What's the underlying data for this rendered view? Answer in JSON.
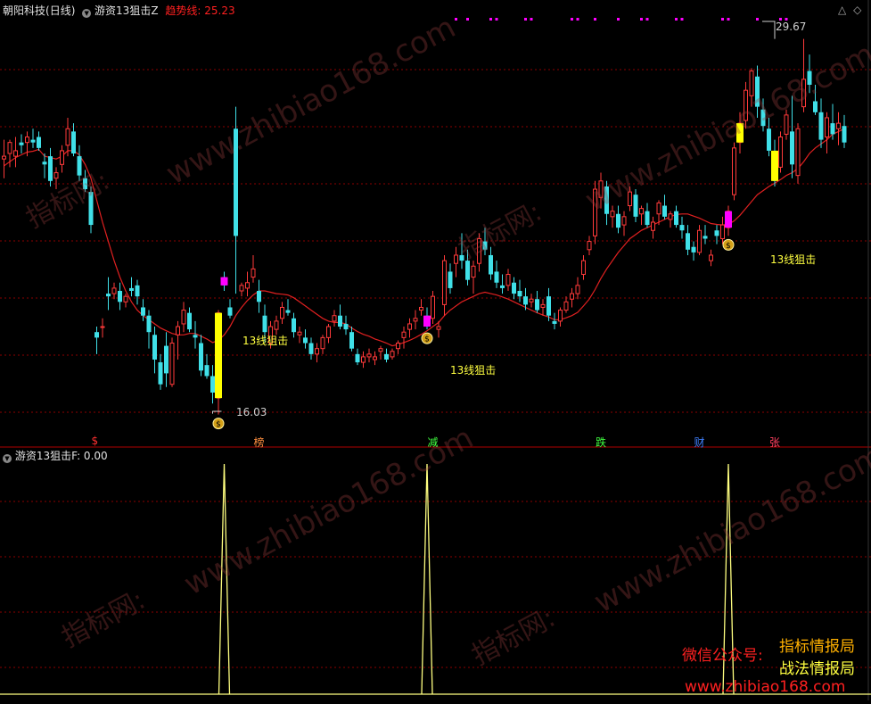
{
  "header": {
    "stock_name": "朝阳科技",
    "period": "(日线)",
    "indicator_name": "游资13狙击Z",
    "trend_label": "趋势线:",
    "trend_value": "25.23"
  },
  "sub_header": {
    "indicator_name": "游资13狙击F",
    "value_text": ": 0.00"
  },
  "annotations": {
    "high_label": "29.67",
    "low_label": "16.03",
    "signal_label": "13线狙击"
  },
  "event_marks": [
    {
      "text": "$",
      "color": "#ff3030"
    },
    {
      "text": "榜",
      "color": "#ff9040"
    },
    {
      "text": "减",
      "color": "#40ff40"
    },
    {
      "text": "跌",
      "color": "#40ff40"
    },
    {
      "text": "财",
      "color": "#4080ff"
    },
    {
      "text": "张",
      "color": "#ff4060"
    }
  ],
  "promo": {
    "wechat": "微信公众号:",
    "line1": "指标情报局",
    "line2": "战法情报局",
    "site": "www.zhibiao168.com"
  },
  "watermark": {
    "site": "www.zhibiao168.com",
    "cn": "指标网:"
  },
  "colors": {
    "up": "#ff3a3a",
    "down": "#40e0e8",
    "trend_line": "#e02020",
    "signal_bar": "#ffff00",
    "magenta_bar": "#ff00ff",
    "grid": "#8b0000",
    "spike": "#ffff80",
    "border": "#b00000"
  },
  "icons": [
    "money-bag-icon",
    "collapse-triangle-icon",
    "diamond-icon"
  ],
  "chart_data": {
    "type": "candlestick",
    "title": "朝阳科技 (日线)",
    "ylim": [
      15.5,
      30.5
    ],
    "labeled_high": 29.67,
    "labeled_low": 16.03,
    "trend_line_last": 25.23,
    "candles": [
      [
        25.3,
        26.0,
        24.6,
        25.4
      ],
      [
        25.5,
        26.0,
        25.0,
        25.9
      ],
      [
        25.4,
        26.1,
        25.0,
        25.6
      ],
      [
        25.9,
        26.2,
        25.5,
        25.8
      ],
      [
        25.9,
        26.3,
        25.4,
        26.1
      ],
      [
        26.0,
        26.4,
        25.7,
        25.9
      ],
      [
        26.1,
        26.3,
        25.6,
        25.7
      ],
      [
        25.2,
        25.5,
        24.6,
        25.1
      ],
      [
        25.4,
        25.7,
        24.3,
        24.5
      ],
      [
        24.6,
        25.0,
        24.2,
        24.8
      ],
      [
        25.1,
        25.8,
        24.8,
        25.6
      ],
      [
        25.8,
        26.8,
        25.4,
        26.4
      ],
      [
        26.3,
        26.6,
        25.4,
        25.5
      ],
      [
        25.4,
        25.8,
        24.5,
        24.7
      ],
      [
        24.6,
        24.9,
        24.1,
        24.2
      ],
      [
        24.1,
        24.3,
        22.6,
        22.9
      ],
      [
        19.0,
        19.2,
        18.2,
        18.8
      ],
      [
        19.2,
        19.5,
        18.8,
        19.2
      ],
      [
        20.4,
        21.0,
        19.8,
        20.3
      ],
      [
        20.4,
        20.8,
        20.2,
        20.6
      ],
      [
        20.5,
        20.8,
        19.8,
        20.1
      ],
      [
        20.1,
        20.4,
        19.9,
        20.3
      ],
      [
        20.6,
        21.0,
        20.3,
        20.5
      ],
      [
        20.7,
        20.9,
        20.0,
        20.3
      ],
      [
        19.9,
        20.2,
        19.4,
        19.6
      ],
      [
        19.6,
        19.8,
        18.4,
        19.0
      ],
      [
        18.9,
        19.2,
        17.5,
        18.0
      ],
      [
        17.9,
        18.2,
        16.9,
        17.1
      ],
      [
        18.5,
        19.0,
        17.0,
        17.5
      ],
      [
        17.1,
        18.8,
        17.0,
        18.6
      ],
      [
        18.9,
        19.4,
        18.0,
        19.2
      ],
      [
        19.3,
        20.1,
        19.0,
        19.8
      ],
      [
        19.7,
        19.9,
        19.0,
        19.1
      ],
      [
        18.9,
        19.4,
        18.4,
        18.8
      ],
      [
        18.6,
        18.9,
        17.4,
        17.6
      ],
      [
        17.8,
        18.2,
        17.3,
        17.4
      ],
      [
        17.4,
        17.8,
        16.4,
        16.8
      ],
      [
        16.6,
        19.8,
        16.0,
        19.7
      ],
      [
        21.0,
        21.2,
        20.5,
        20.7
      ],
      [
        19.9,
        20.2,
        19.5,
        19.6
      ],
      [
        26.4,
        27.2,
        20.4,
        22.5
      ],
      [
        20.5,
        20.8,
        20.3,
        20.7
      ],
      [
        20.6,
        21.2,
        20.3,
        20.8
      ],
      [
        21.0,
        21.8,
        20.8,
        21.3
      ],
      [
        20.5,
        20.9,
        19.7,
        20.1
      ],
      [
        19.6,
        20.0,
        18.6,
        19.0
      ],
      [
        18.6,
        19.4,
        18.4,
        19.2
      ],
      [
        19.1,
        19.6,
        18.9,
        19.4
      ],
      [
        19.5,
        20.1,
        19.3,
        19.9
      ],
      [
        19.8,
        20.2,
        19.6,
        19.7
      ],
      [
        19.5,
        19.7,
        18.8,
        19.0
      ],
      [
        18.9,
        19.2,
        18.6,
        19.0
      ],
      [
        18.8,
        19.1,
        18.4,
        18.6
      ],
      [
        18.6,
        18.8,
        18.0,
        18.2
      ],
      [
        18.2,
        18.6,
        17.9,
        18.4
      ],
      [
        18.4,
        18.9,
        18.2,
        18.8
      ],
      [
        18.8,
        19.3,
        18.6,
        19.2
      ],
      [
        19.4,
        19.8,
        19.2,
        19.6
      ],
      [
        19.6,
        20.0,
        19.1,
        19.2
      ],
      [
        19.3,
        19.6,
        18.9,
        19.1
      ],
      [
        19.0,
        19.2,
        18.3,
        18.4
      ],
      [
        18.2,
        18.4,
        17.8,
        17.9
      ],
      [
        17.9,
        18.3,
        17.7,
        18.1
      ],
      [
        18.1,
        18.4,
        17.9,
        18.2
      ],
      [
        18.0,
        18.3,
        17.8,
        18.1
      ],
      [
        18.3,
        18.5,
        18.0,
        18.4
      ],
      [
        18.2,
        18.4,
        17.9,
        18.0
      ],
      [
        18.1,
        18.4,
        18.0,
        18.3
      ],
      [
        18.4,
        18.7,
        18.2,
        18.6
      ],
      [
        18.8,
        19.2,
        18.4,
        19.0
      ],
      [
        19.1,
        19.5,
        18.8,
        19.3
      ],
      [
        19.4,
        19.8,
        19.1,
        19.5
      ],
      [
        19.8,
        20.2,
        19.6,
        19.9
      ],
      [
        19.6,
        19.9,
        19.1,
        19.2
      ],
      [
        19.5,
        20.5,
        19.3,
        20.3
      ],
      [
        19.1,
        19.4,
        18.8,
        19.2
      ],
      [
        20.0,
        21.8,
        19.6,
        21.6
      ],
      [
        21.2,
        21.5,
        20.4,
        20.6
      ],
      [
        21.5,
        22.1,
        21.0,
        21.8
      ],
      [
        21.8,
        22.6,
        21.3,
        21.6
      ],
      [
        21.6,
        22.0,
        20.7,
        20.9
      ],
      [
        21.0,
        21.6,
        20.4,
        21.4
      ],
      [
        21.5,
        22.6,
        21.2,
        22.4
      ],
      [
        22.3,
        22.8,
        21.8,
        22.0
      ],
      [
        21.8,
        22.1,
        20.9,
        21.1
      ],
      [
        21.2,
        21.6,
        20.6,
        20.8
      ],
      [
        20.7,
        21.1,
        20.4,
        20.6
      ],
      [
        20.7,
        21.3,
        20.5,
        21.1
      ],
      [
        20.8,
        21.0,
        20.2,
        20.4
      ],
      [
        20.5,
        20.9,
        20.1,
        20.3
      ],
      [
        20.3,
        20.6,
        19.8,
        20.0
      ],
      [
        20.1,
        20.4,
        19.9,
        20.2
      ],
      [
        20.2,
        20.5,
        19.7,
        19.8
      ],
      [
        19.9,
        20.2,
        19.6,
        20.0
      ],
      [
        20.3,
        20.6,
        19.4,
        19.6
      ],
      [
        19.4,
        19.7,
        19.1,
        19.3
      ],
      [
        19.4,
        19.9,
        19.2,
        19.8
      ],
      [
        19.8,
        20.3,
        19.7,
        20.1
      ],
      [
        20.2,
        20.6,
        19.9,
        20.4
      ],
      [
        20.4,
        21.0,
        20.2,
        20.7
      ],
      [
        21.1,
        21.8,
        20.9,
        21.6
      ],
      [
        22.0,
        22.5,
        21.8,
        22.3
      ],
      [
        22.5,
        24.5,
        22.2,
        24.2
      ],
      [
        23.9,
        24.8,
        23.5,
        24.5
      ],
      [
        24.3,
        24.5,
        22.9,
        23.3
      ],
      [
        23.2,
        23.6,
        22.8,
        23.4
      ],
      [
        23.3,
        23.6,
        22.6,
        22.8
      ],
      [
        22.9,
        23.4,
        22.5,
        23.2
      ],
      [
        23.6,
        24.3,
        23.4,
        24.1
      ],
      [
        24.0,
        24.2,
        23.0,
        23.2
      ],
      [
        23.3,
        23.6,
        22.9,
        23.5
      ],
      [
        23.4,
        23.7,
        22.8,
        22.9
      ],
      [
        22.7,
        23.2,
        22.4,
        23.0
      ],
      [
        23.3,
        23.8,
        22.9,
        23.7
      ],
      [
        23.6,
        24.0,
        23.1,
        23.2
      ],
      [
        23.1,
        23.4,
        22.8,
        23.3
      ],
      [
        23.4,
        23.6,
        22.8,
        22.9
      ],
      [
        22.9,
        23.2,
        22.4,
        22.7
      ],
      [
        22.6,
        22.9,
        21.8,
        22.0
      ],
      [
        22.1,
        22.3,
        21.6,
        21.9
      ],
      [
        21.9,
        22.9,
        21.8,
        22.7
      ],
      [
        22.5,
        22.9,
        22.2,
        22.4
      ],
      [
        21.6,
        22.0,
        21.4,
        21.8
      ],
      [
        22.7,
        22.9,
        22.2,
        22.5
      ],
      [
        22.4,
        23.2,
        22.2,
        22.9
      ],
      [
        22.8,
        23.6,
        22.5,
        23.4
      ],
      [
        24.0,
        25.9,
        23.8,
        25.7
      ],
      [
        25.9,
        27.0,
        25.5,
        26.6
      ],
      [
        26.7,
        28.1,
        26.4,
        27.8
      ],
      [
        27.6,
        28.6,
        27.2,
        28.5
      ],
      [
        28.3,
        28.7,
        26.8,
        27.2
      ],
      [
        27.1,
        27.5,
        26.3,
        26.5
      ],
      [
        26.4,
        26.8,
        25.4,
        25.6
      ],
      [
        25.6,
        26.0,
        24.3,
        24.5
      ],
      [
        25.0,
        26.3,
        24.8,
        26.1
      ],
      [
        26.2,
        27.1,
        26.0,
        26.9
      ],
      [
        26.3,
        27.6,
        24.6,
        25.1
      ],
      [
        24.7,
        26.6,
        24.4,
        26.4
      ],
      [
        27.2,
        29.67,
        27.0,
        28.2
      ],
      [
        28.5,
        29.1,
        27.7,
        28.0
      ],
      [
        27.4,
        28.0,
        26.9,
        27.0
      ],
      [
        27.0,
        27.5,
        25.7,
        26.0
      ],
      [
        26.1,
        27.0,
        25.5,
        26.8
      ],
      [
        26.6,
        27.3,
        26.0,
        26.2
      ],
      [
        26.4,
        27.0,
        25.8,
        26.6
      ],
      [
        26.5,
        26.9,
        25.7,
        25.9
      ]
    ],
    "trend_line": [
      25.05,
      25.2,
      25.35,
      25.45,
      25.55,
      25.58,
      25.65,
      25.4,
      25.35,
      25.3,
      25.4,
      25.6,
      25.6,
      25.45,
      25.1,
      24.6,
      23.8,
      23.0,
      22.3,
      21.6,
      21.0,
      20.5,
      20.1,
      19.8,
      19.6,
      19.45,
      19.3,
      19.15,
      19.05,
      18.95,
      18.9,
      18.9,
      18.95,
      18.95,
      18.85,
      18.75,
      18.62,
      18.7,
      18.9,
      19.2,
      19.6,
      19.9,
      20.15,
      20.35,
      20.5,
      20.5,
      20.45,
      20.4,
      20.38,
      20.35,
      20.25,
      20.1,
      19.95,
      19.8,
      19.65,
      19.5,
      19.4,
      19.35,
      19.35,
      19.3,
      19.15,
      19.02,
      18.92,
      18.85,
      18.75,
      18.68,
      18.6,
      18.5,
      18.55,
      18.62,
      18.7,
      18.8,
      18.92,
      19.05,
      19.2,
      19.35,
      19.6,
      19.8,
      19.95,
      20.1,
      20.2,
      20.3,
      20.4,
      20.45,
      20.4,
      20.35,
      20.28,
      20.2,
      20.1,
      20.0,
      19.9,
      19.8,
      19.7,
      19.62,
      19.55,
      19.45,
      19.45,
      19.52,
      19.6,
      19.72,
      19.95,
      20.2,
      20.55,
      20.95,
      21.3,
      21.6,
      21.9,
      22.15,
      22.4,
      22.55,
      22.7,
      22.8,
      22.9,
      23.0,
      23.1,
      23.2,
      23.28,
      23.3,
      23.3,
      23.22,
      23.15,
      23.05,
      22.95,
      22.92,
      22.9,
      22.92,
      23.05,
      23.25,
      23.5,
      23.75,
      24.0,
      24.15,
      24.3,
      24.42,
      24.55,
      24.7,
      24.8,
      24.95,
      25.2,
      25.5,
      25.7,
      25.85,
      26.0,
      26.2,
      26.3,
      26.4
    ],
    "signals": [
      {
        "index": 37,
        "type": "13线狙击"
      },
      {
        "index": 73,
        "type": "13线狙击"
      },
      {
        "index": 125,
        "type": "13线狙击"
      }
    ],
    "signal_bars": [
      {
        "index": 37,
        "color": "yellow"
      },
      {
        "index": 38,
        "color": "magenta"
      },
      {
        "index": 73,
        "color": "magenta"
      },
      {
        "index": 125,
        "color": "magenta"
      },
      {
        "index": 127,
        "color": "yellow"
      },
      {
        "index": 133,
        "color": "yellow"
      }
    ],
    "top_dots": [
      78,
      80,
      84,
      85,
      90,
      91,
      98,
      99,
      102,
      106,
      110,
      111,
      116,
      117,
      124,
      125,
      130,
      134,
      135
    ],
    "event_indices": [
      16,
      44,
      74,
      103,
      120,
      133
    ],
    "sub_indicator": {
      "name": "游资13狙击F",
      "ylim": [
        0,
        1
      ],
      "spikes": [
        38,
        73,
        125
      ]
    }
  }
}
